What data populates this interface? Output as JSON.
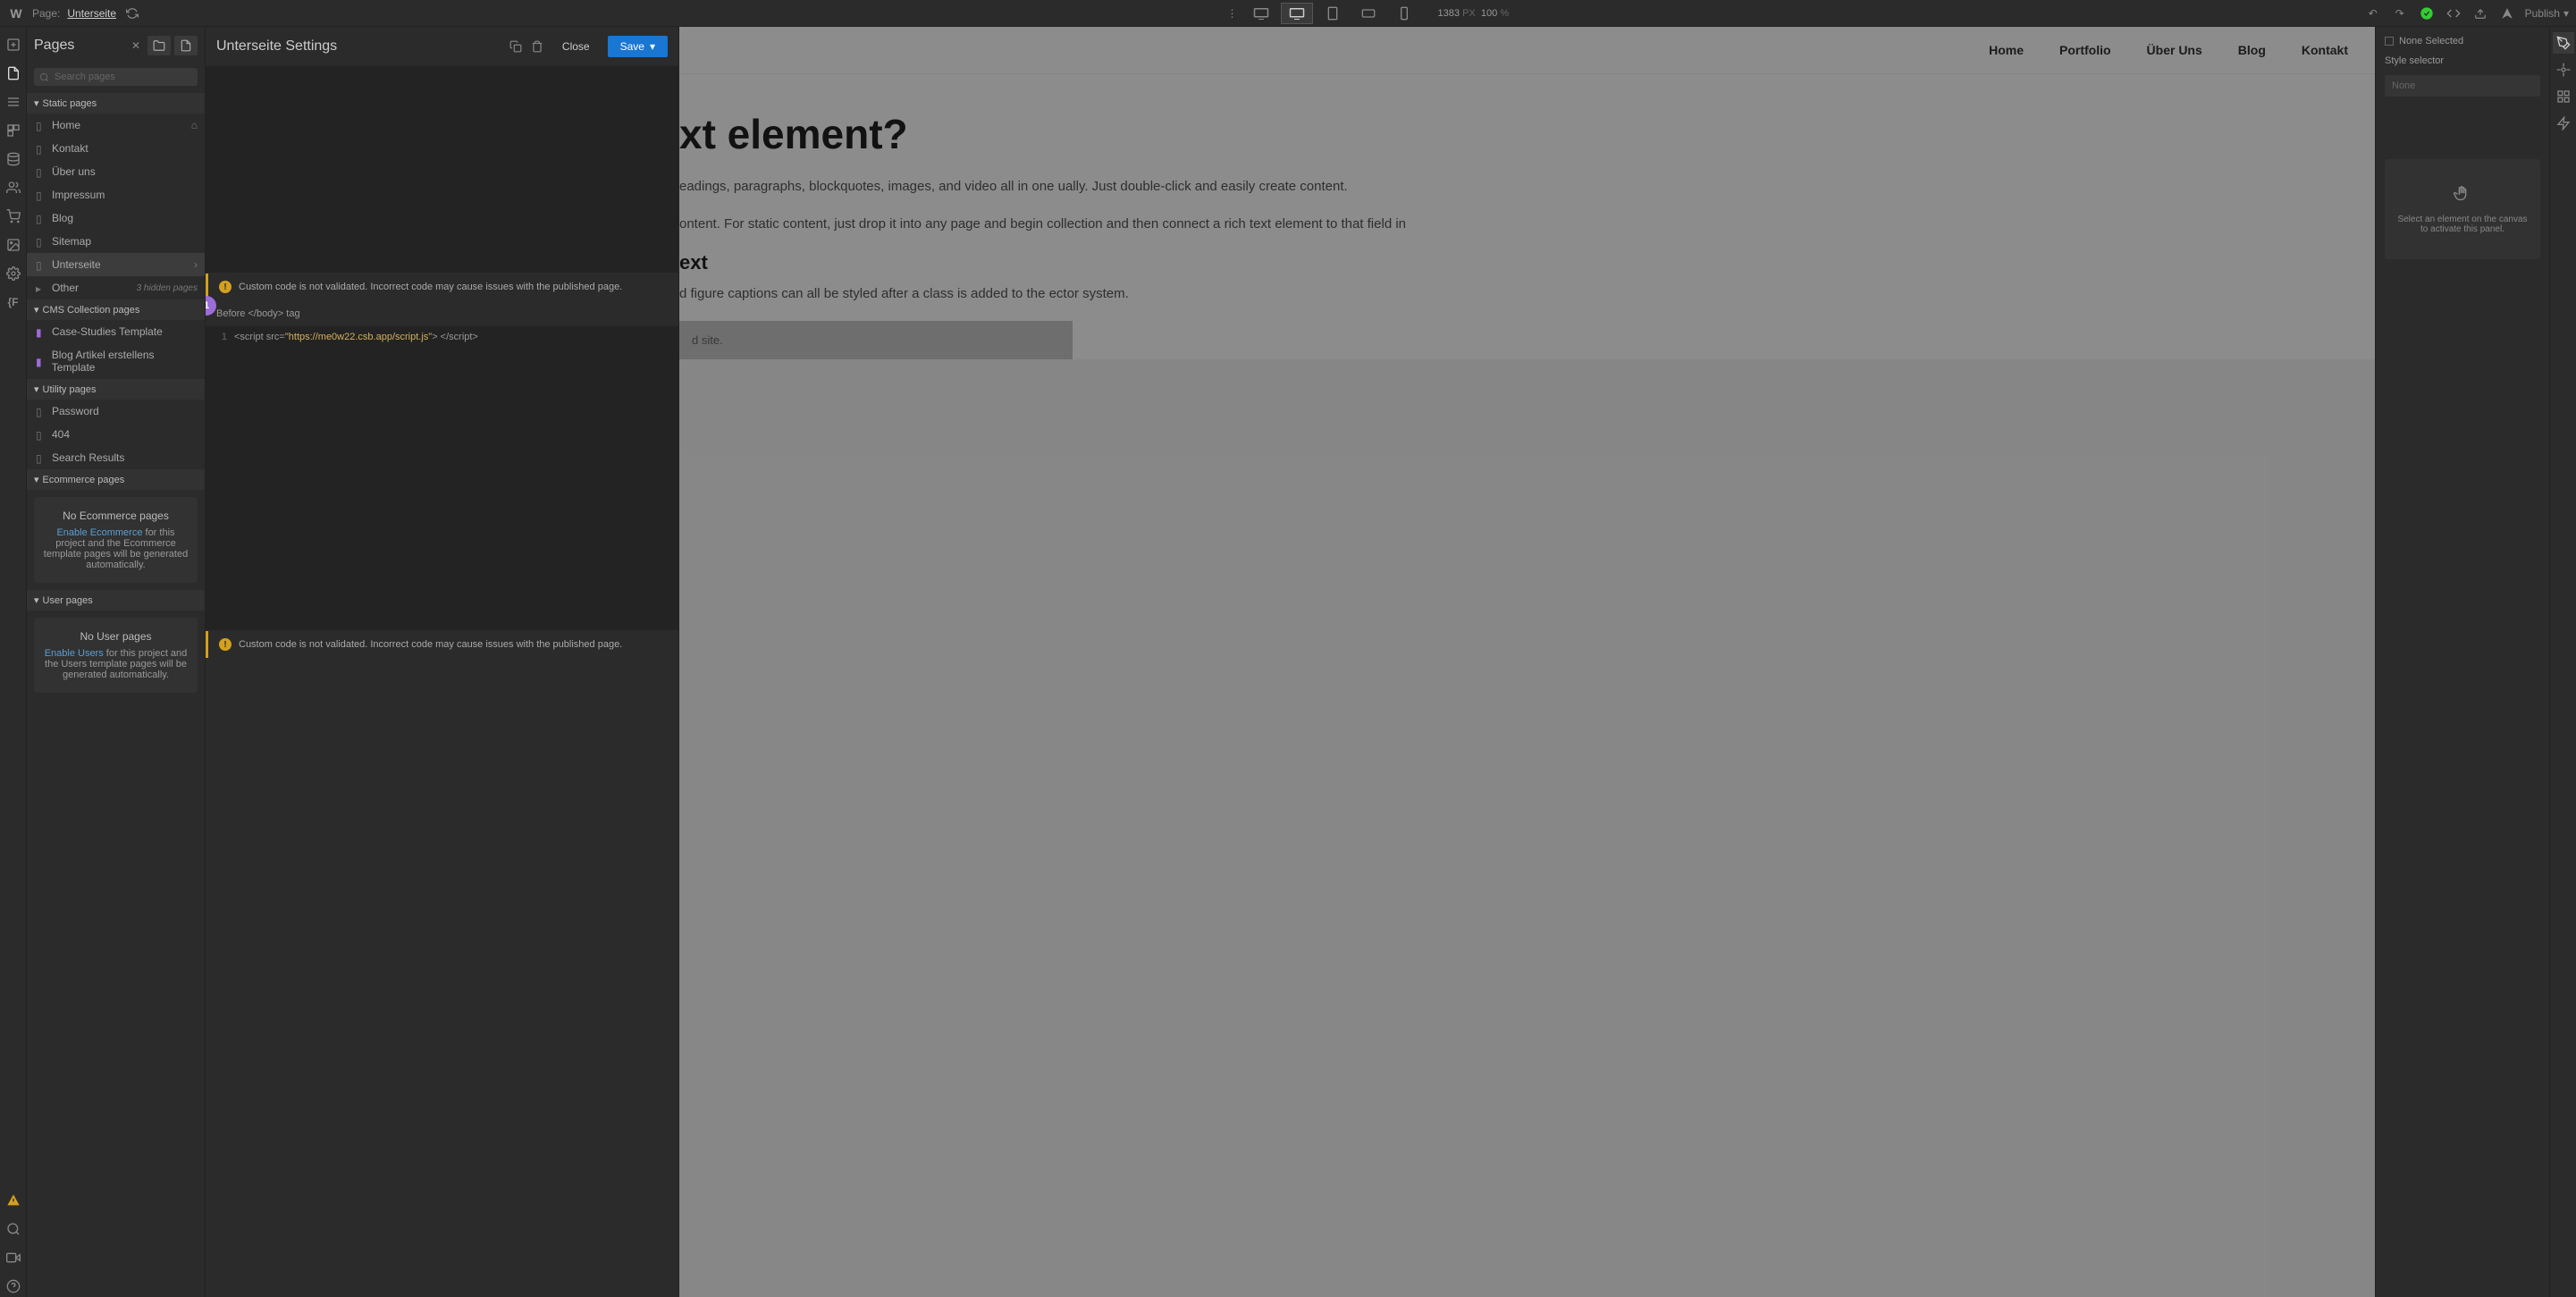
{
  "topbar": {
    "page_label": "Page:",
    "page_name": "Unterseite",
    "width_px": "1383",
    "px_label": "PX",
    "zoom": "100",
    "zoom_label": "%",
    "publish": "Publish"
  },
  "pages_panel": {
    "title": "Pages",
    "search_placeholder": "Search pages",
    "groups": {
      "static": "Static pages",
      "cms": "CMS Collection pages",
      "utility": "Utility pages",
      "ecommerce": "Ecommerce pages",
      "user": "User pages"
    },
    "static_items": [
      "Home",
      "Kontakt",
      "Über uns",
      "Impressum",
      "Blog",
      "Sitemap",
      "Unterseite"
    ],
    "other_label": "Other",
    "hidden_count": "3 hidden pages",
    "cms_items": [
      "Case-Studies Template",
      "Blog Artikel erstellens Template"
    ],
    "utility_items": [
      "Password",
      "404",
      "Search Results"
    ],
    "ecom_empty": {
      "title": "No Ecommerce pages",
      "link": "Enable Ecommerce",
      "text": " for this project and the Ecommerce template pages will be generated automatically."
    },
    "user_empty": {
      "title": "No User pages",
      "link": "Enable Users",
      "text": " for this project and the Users template pages will be generated automatically."
    }
  },
  "settings": {
    "title": "Unterseite Settings",
    "close": "Close",
    "save": "Save",
    "warn": "Custom code is not validated. Incorrect code may cause issues with the published page.",
    "before_body": "Before </body> tag",
    "code_line_no": "1",
    "code": {
      "tag_open": "<script ",
      "attr": "src=",
      "str": "\"https://me0w22.csb.app/script.js\"",
      "tag_mid": "> ",
      "tag_close": "</script>"
    },
    "step_marker": "1"
  },
  "canvas": {
    "nav": [
      "Home",
      "Portfolio",
      "Über Uns",
      "Blog",
      "Kontakt"
    ],
    "heading": "xt element?",
    "p1": "eadings, paragraphs, blockquotes, images, and video all in one ually. Just double-click and easily create content.",
    "p2": "ontent. For static content, just drop it into any page and begin  collection and then connect a rich text element to that field in",
    "sub": "ext",
    "p3": "d figure captions can all be styled after a class is added to the ector system.",
    "embed": "d site."
  },
  "right_panel": {
    "none_selected": "None Selected",
    "style_selector": "Style selector",
    "sel_none": "None",
    "placeholder": "Select an element on the canvas to activate this panel."
  }
}
